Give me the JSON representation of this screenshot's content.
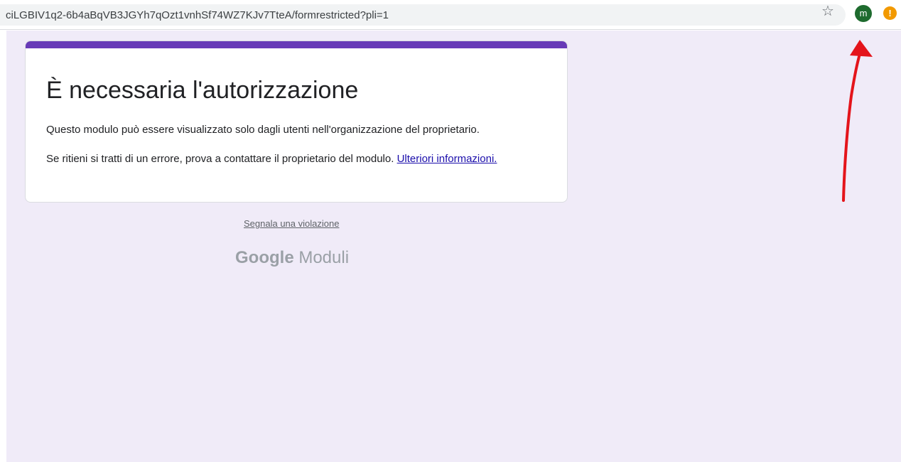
{
  "browser": {
    "url": "ciLGBIV1q2-6b4aBqVB3JGYh7qOzt1vnhSf74WZ7KJv7TteA/formrestricted?pli=1",
    "avatar_letter": "m",
    "star_icon": "star-icon",
    "alert_icon": "alert-icon",
    "alert_glyph": "!"
  },
  "card": {
    "title": "È necessaria l'autorizzazione",
    "message": "Questo modulo può essere visualizzato solo dagli utenti nell'organizzazione del proprietario.",
    "error_text": "Se ritieni si tratti di un errore, prova a contattare il proprietario del modulo.",
    "more_info_link": "Ulteriori informazioni.",
    "accent_color": "#673ab7"
  },
  "footer": {
    "report_link": "Segnala una violazione",
    "brand_google": "Google",
    "brand_product": "Moduli"
  },
  "colors": {
    "page_background": "#f0ebf8",
    "avatar": "#1e6b2e",
    "alert": "#f29900",
    "annotation_arrow": "#e4141b"
  }
}
